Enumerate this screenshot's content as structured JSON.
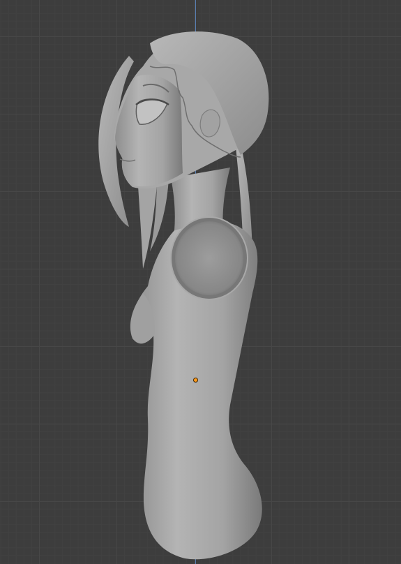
{
  "viewport": {
    "background": "#3d3d3d",
    "grid_major_color": "#474747",
    "grid_minor_color": "#414141",
    "axis_z_color": "#5a80b5",
    "origin_color": "#ff9a1a"
  },
  "scene": {
    "object_icon": "sculpt-mesh",
    "origin_icon": "object-origin-dot"
  }
}
